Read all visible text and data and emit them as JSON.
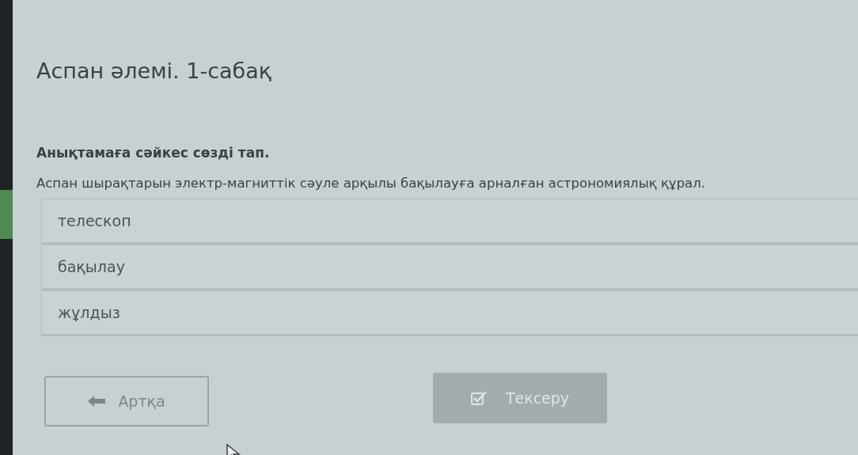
{
  "lesson": {
    "title": "Аспан әлемі. 1-сабақ"
  },
  "question": {
    "prompt": "Анықтамаға сәйкес сөзді тап.",
    "text": "Аспан шырақтарын электр-магниттік сәуле арқылы бақылауға арналған астрономиялық құрал."
  },
  "options": [
    {
      "label": "телескоп",
      "selected": false
    },
    {
      "label": "бақылау",
      "selected": false
    },
    {
      "label": "жұлдыз",
      "selected": false
    }
  ],
  "buttons": [
    {
      "kind": "back",
      "label": "Артқа",
      "disabled": false
    },
    {
      "kind": "check",
      "label": "Тексеру",
      "disabled": true
    }
  ]
}
